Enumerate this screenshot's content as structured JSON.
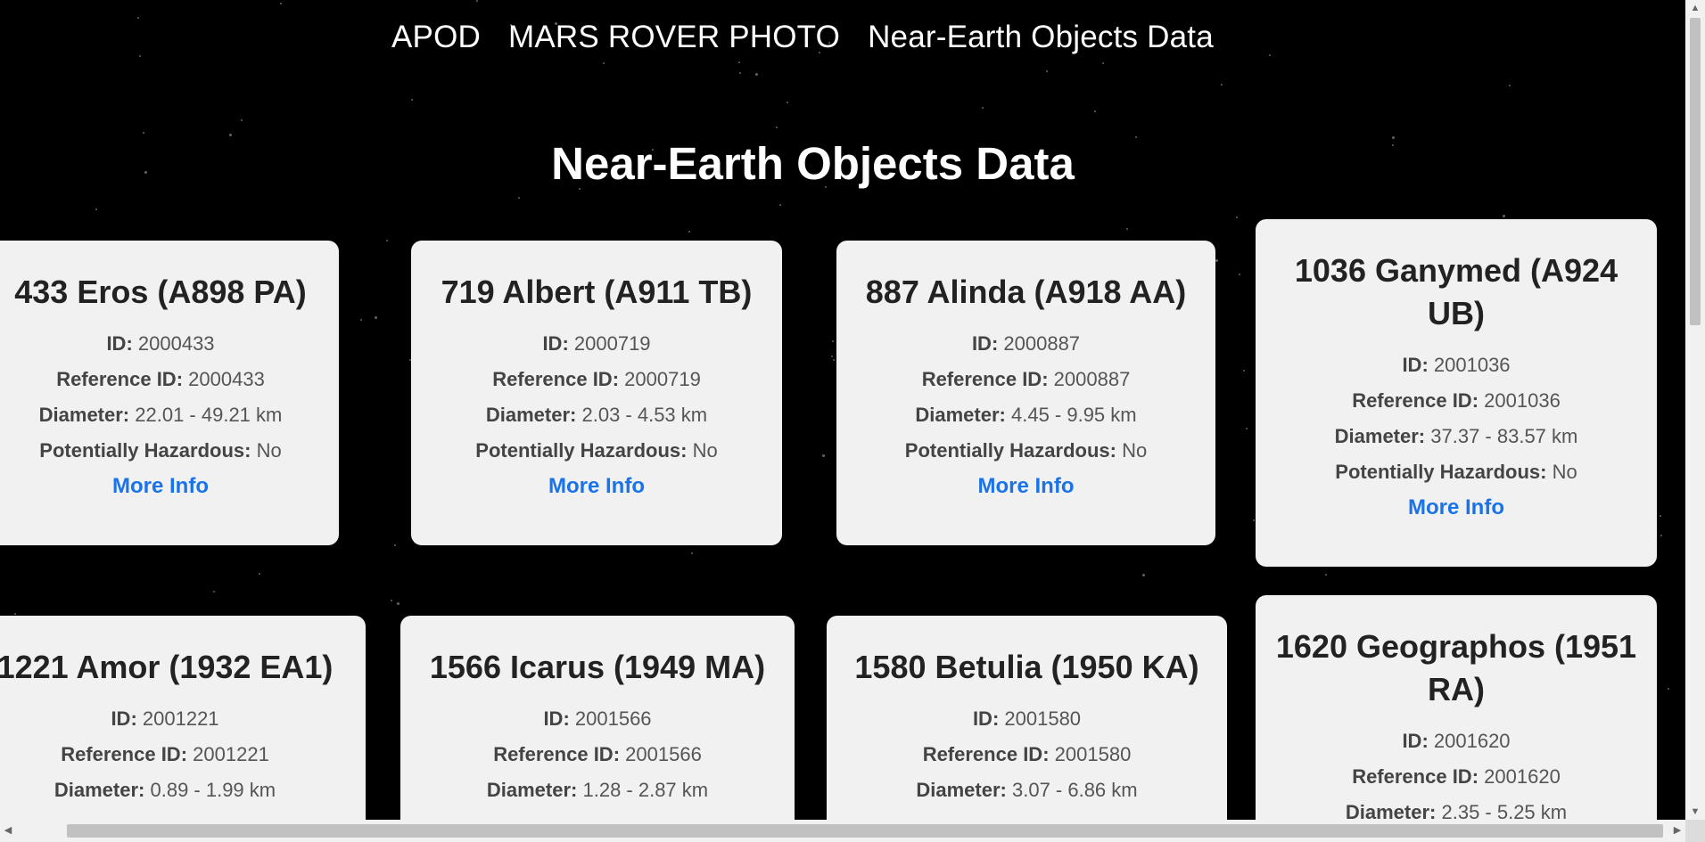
{
  "nav": {
    "items": [
      "APOD",
      "MARS ROVER PHOTO",
      "Near-Earth Objects Data"
    ]
  },
  "page_title": "Near-Earth Objects Data",
  "labels": {
    "id": "ID:",
    "reference_id": "Reference ID:",
    "diameter": "Diameter:",
    "hazardous": "Potentially Hazardous:",
    "more_info": "More Info"
  },
  "objects": [
    {
      "name": "433 Eros (A898 PA)",
      "id": "2000433",
      "reference_id": "2000433",
      "diameter": "22.01 - 49.21 km",
      "hazardous": "No"
    },
    {
      "name": "719 Albert (A911 TB)",
      "id": "2000719",
      "reference_id": "2000719",
      "diameter": "2.03 - 4.53 km",
      "hazardous": "No"
    },
    {
      "name": "887 Alinda (A918 AA)",
      "id": "2000887",
      "reference_id": "2000887",
      "diameter": "4.45 - 9.95 km",
      "hazardous": "No"
    },
    {
      "name": "1036 Ganymed (A924 UB)",
      "id": "2001036",
      "reference_id": "2001036",
      "diameter": "37.37 - 83.57 km",
      "hazardous": "No"
    },
    {
      "name": "1221 Amor (1932 EA1)",
      "id": "2001221",
      "reference_id": "2001221",
      "diameter": "0.89 - 1.99 km",
      "hazardous": ""
    },
    {
      "name": "1566 Icarus (1949 MA)",
      "id": "2001566",
      "reference_id": "2001566",
      "diameter": "1.28 - 2.87 km",
      "hazardous": ""
    },
    {
      "name": "1580 Betulia (1950 KA)",
      "id": "2001580",
      "reference_id": "2001580",
      "diameter": "3.07 - 6.86 km",
      "hazardous": ""
    },
    {
      "name": "1620 Geographos (1951 RA)",
      "id": "2001620",
      "reference_id": "2001620",
      "diameter": "2.35 - 5.25 km",
      "hazardous": ""
    }
  ],
  "colors": {
    "background": "#000000",
    "card": "#f1f1f1",
    "link": "#1a73e8"
  }
}
